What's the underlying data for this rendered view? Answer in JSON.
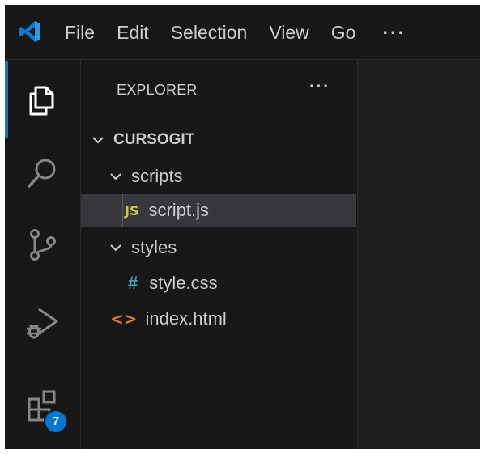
{
  "menu": {
    "items": [
      "File",
      "Edit",
      "Selection",
      "View",
      "Go"
    ],
    "more": "···"
  },
  "activity_bar": {
    "items": [
      {
        "icon": "explorer-icon",
        "active": true
      },
      {
        "icon": "search-icon",
        "active": false
      },
      {
        "icon": "source-control-icon",
        "active": false
      },
      {
        "icon": "run-debug-icon",
        "active": false
      },
      {
        "icon": "extensions-icon",
        "active": false
      }
    ],
    "extensions_badge": "7",
    "accent_color": "#0078d4"
  },
  "sidebar": {
    "title": "EXPLORER",
    "more": "···",
    "root": "CURSOGIT",
    "tree": [
      {
        "label": "scripts",
        "type": "folder",
        "expanded": true
      },
      {
        "label": "script.js",
        "type": "file",
        "icon_text": "JS",
        "icon_color": "#cbcb41",
        "selected": true
      },
      {
        "label": "styles",
        "type": "folder",
        "expanded": true
      },
      {
        "label": "style.css",
        "type": "file",
        "icon_text": "#",
        "icon_color": "#519aba",
        "selected": false
      },
      {
        "label": "index.html",
        "type": "file",
        "icon_text": "<>",
        "icon_color": "#e37933",
        "selected": false
      }
    ]
  }
}
